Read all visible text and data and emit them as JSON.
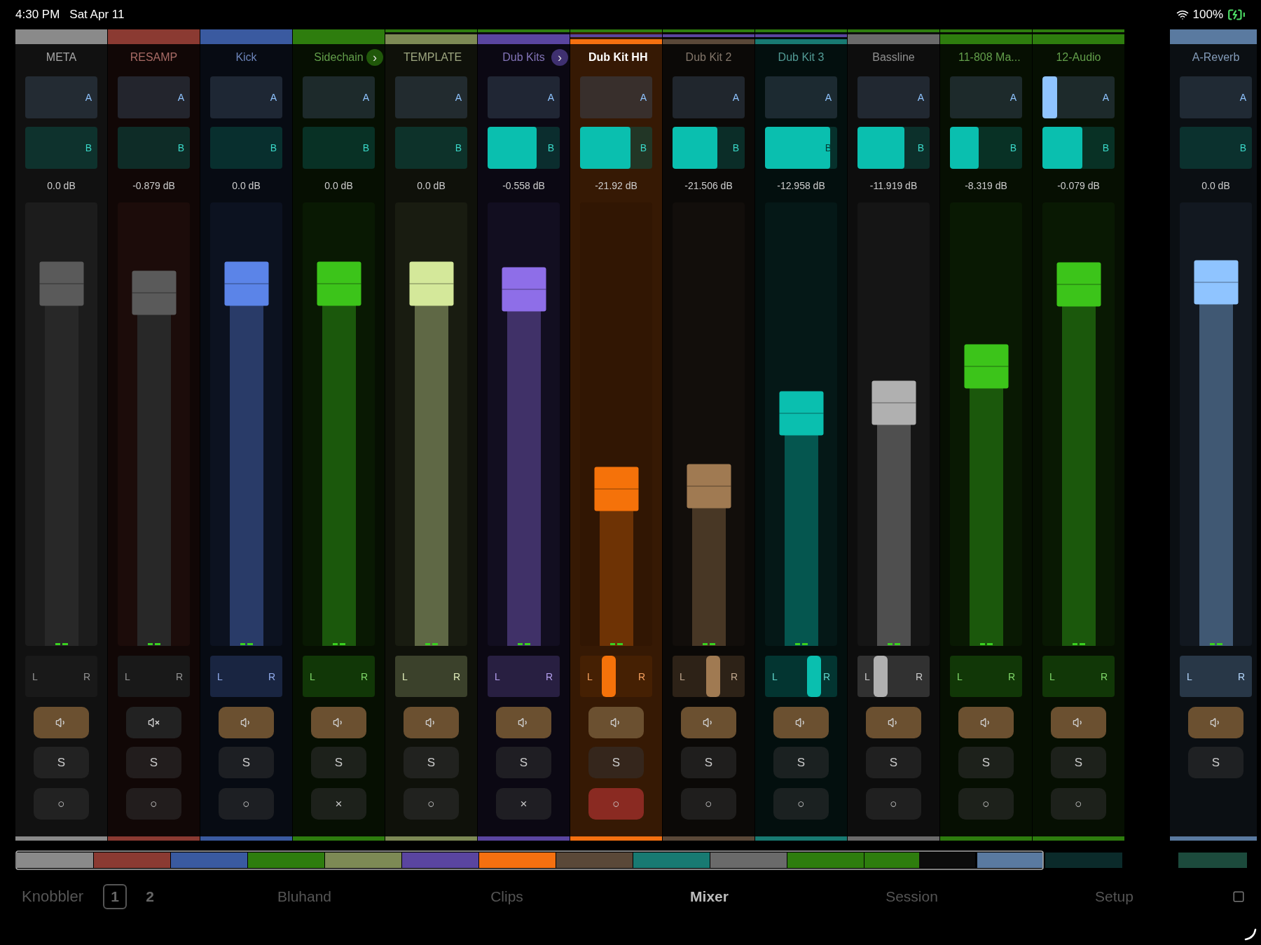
{
  "status_bar": {
    "time": "4:30 PM",
    "date": "Sat Apr 11",
    "battery": "100%"
  },
  "channels": [
    {
      "name": "META",
      "color": "#8a8a8a",
      "selected": false,
      "send_a": {
        "label": "A"
      },
      "send_b": {
        "label": "B"
      },
      "volume": "0.0 dB",
      "fader": {
        "level": 0.817,
        "color": "#5a5a5a"
      },
      "pan": {
        "left": "L",
        "right": "R"
      },
      "mute": {
        "muted": false
      },
      "solo": {
        "label": "S"
      },
      "arm": {
        "symbol": "○",
        "armed": false
      }
    },
    {
      "name": "RESAMP",
      "color": "#8b3a32",
      "selected": false,
      "send_a": {
        "label": "A"
      },
      "send_b": {
        "label": "B"
      },
      "volume": "-0.879 dB",
      "fader": {
        "level": 0.797,
        "color": "#5a5a5a"
      },
      "pan": {
        "left": "L",
        "right": "R"
      },
      "mute": {
        "muted": true
      },
      "solo": {
        "label": "S"
      },
      "arm": {
        "symbol": "○",
        "armed": false
      }
    },
    {
      "name": "Kick",
      "color": "#3a5aa0",
      "selected": false,
      "send_a": {
        "label": "A"
      },
      "send_b": {
        "label": "B"
      },
      "volume": "0.0 dB",
      "fader": {
        "level": 0.817,
        "color": "#5b84e8"
      },
      "pan": {
        "left": "L",
        "right": "R"
      },
      "mute": {
        "muted": false
      },
      "solo": {
        "label": "S"
      },
      "arm": {
        "symbol": "○",
        "armed": false
      }
    },
    {
      "name": "Sidechain",
      "color": "#2e7d0e",
      "selected": false,
      "toggle": "›",
      "send_a": {
        "label": "A"
      },
      "send_b": {
        "label": "B"
      },
      "volume": "0.0 dB",
      "fader": {
        "level": 0.817,
        "color": "#3cc41a"
      },
      "pan": {
        "left": "L",
        "right": "R"
      },
      "mute": {
        "muted": false
      },
      "solo": {
        "label": "S"
      },
      "arm": {
        "symbol": "×",
        "armed": false
      },
      "children": [
        {
          "name": "TEMPLATE",
          "color": "#7d8a55",
          "selected": false,
          "send_a": {
            "label": "A"
          },
          "send_b": {
            "label": "B"
          },
          "volume": "0.0 dB",
          "fader": {
            "level": 0.817,
            "color": "#d4e89a"
          },
          "pan": {
            "left": "L",
            "right": "R"
          },
          "mute": {
            "muted": false
          },
          "solo": {
            "label": "S"
          },
          "arm": {
            "symbol": "○",
            "armed": false
          }
        },
        {
          "name": "Dub Kits",
          "color": "#5a45a0",
          "selected": false,
          "toggle": "›",
          "send_a": {
            "label": "A"
          },
          "send_b": {
            "label": "B",
            "level": 0.68
          },
          "volume": "-0.558 dB",
          "fader": {
            "level": 0.804,
            "color": "#8e6ee8"
          },
          "pan": {
            "left": "L",
            "right": "R"
          },
          "mute": {
            "muted": false
          },
          "solo": {
            "label": "S"
          },
          "arm": {
            "symbol": "×",
            "armed": false
          },
          "children": [
            {
              "name": "Dub Kit HH",
              "color": "#f57010",
              "selected": true,
              "send_a": {
                "label": "A"
              },
              "send_b": {
                "label": "B",
                "level": 0.7
              },
              "volume": "-21.92 dB",
              "fader": {
                "level": 0.354,
                "color": "#f5720a"
              },
              "pan": {
                "left": "L",
                "right": "R",
                "level": 0.4
              },
              "mute": {
                "muted": false
              },
              "solo": {
                "label": "S"
              },
              "arm": {
                "symbol": "○",
                "armed": true
              }
            },
            {
              "name": "Dub Kit 2",
              "color": "#5a4838",
              "selected": false,
              "send_a": {
                "label": "A"
              },
              "send_b": {
                "label": "B",
                "level": 0.62
              },
              "volume": "-21.506 dB",
              "fader": {
                "level": 0.36,
                "color": "#a07a52"
              },
              "pan": {
                "left": "L",
                "right": "R",
                "level": 0.56
              },
              "mute": {
                "muted": false
              },
              "solo": {
                "label": "S"
              },
              "arm": {
                "symbol": "○",
                "armed": false
              }
            },
            {
              "name": "Dub Kit 3",
              "color": "#187a72",
              "selected": false,
              "send_a": {
                "label": "A"
              },
              "send_b": {
                "label": "B",
                "level": 0.9
              },
              "volume": "-12.958 dB",
              "fader": {
                "level": 0.524,
                "color": "#0abfaf"
              },
              "pan": {
                "left": "L",
                "right": "R",
                "level": 0.68
              },
              "mute": {
                "muted": false
              },
              "solo": {
                "label": "S"
              },
              "arm": {
                "symbol": "○",
                "armed": false
              }
            }
          ]
        },
        {
          "name": "Bassline",
          "color": "#6a6a6a",
          "selected": false,
          "send_a": {
            "label": "A"
          },
          "send_b": {
            "label": "B",
            "level": 0.65
          },
          "volume": "-11.919 dB",
          "fader": {
            "level": 0.548,
            "color": "#b0b0b0"
          },
          "pan": {
            "left": "L",
            "right": "R",
            "level": 0.32
          },
          "mute": {
            "muted": false
          },
          "solo": {
            "label": "S"
          },
          "arm": {
            "symbol": "○",
            "armed": false
          }
        },
        {
          "name": "11-808 Ma...",
          "color": "#2e7d0e",
          "selected": false,
          "send_a": {
            "label": "A"
          },
          "send_b": {
            "label": "B",
            "level": 0.4
          },
          "volume": "-8.319 dB",
          "fader": {
            "level": 0.63,
            "color": "#3cc41a"
          },
          "pan": {
            "left": "L",
            "right": "R"
          },
          "mute": {
            "muted": false
          },
          "solo": {
            "label": "S"
          },
          "arm": {
            "symbol": "○",
            "armed": false
          }
        },
        {
          "name": "12-Audio",
          "color": "#2e7d0e",
          "selected": false,
          "send_a": {
            "label": "A",
            "level": 0.2
          },
          "send_b": {
            "label": "B",
            "level": 0.55
          },
          "volume": "-0.079 dB",
          "fader": {
            "level": 0.815,
            "color": "#3cc41a"
          },
          "pan": {
            "left": "L",
            "right": "R"
          },
          "mute": {
            "muted": false
          },
          "solo": {
            "label": "S"
          },
          "arm": {
            "symbol": "○",
            "armed": false
          }
        }
      ]
    }
  ],
  "returns": [
    {
      "name": "A-Reverb",
      "color": "#5a7aa0",
      "selected": false,
      "send_a": {
        "label": "A"
      },
      "send_b": {
        "label": "B"
      },
      "volume": "0.0 dB",
      "fader": {
        "level": 0.82,
        "color": "#8fc4ff"
      },
      "pan": {
        "left": "L",
        "right": "R"
      },
      "mute": {
        "muted": false
      },
      "solo": {
        "label": "S"
      }
    }
  ],
  "nav": {
    "title": "Knobbler",
    "pages": [
      {
        "label": "1",
        "selected": true
      },
      {
        "label": "2",
        "selected": false
      }
    ],
    "tabs": [
      {
        "label": "Bluhand",
        "selected": false
      },
      {
        "label": "Clips",
        "selected": false
      },
      {
        "label": "Mixer",
        "selected": true
      },
      {
        "label": "Session",
        "selected": false
      },
      {
        "label": "Setup",
        "selected": false
      }
    ]
  }
}
